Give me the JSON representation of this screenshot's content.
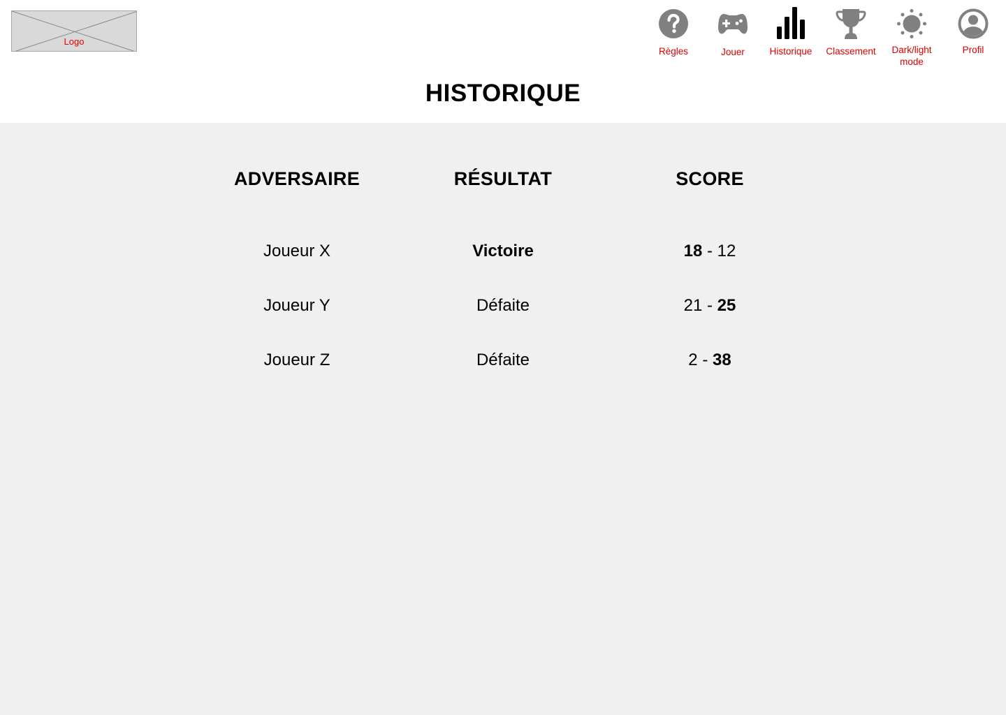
{
  "logo": {
    "label": "Logo"
  },
  "nav": [
    {
      "id": "regles",
      "label": "Règles",
      "icon": "question-circle-icon"
    },
    {
      "id": "jouer",
      "label": "Jouer",
      "icon": "gamepad-icon"
    },
    {
      "id": "historique",
      "label": "Historique",
      "icon": "bar-chart-icon"
    },
    {
      "id": "classement",
      "label": "Classement",
      "icon": "trophy-icon"
    },
    {
      "id": "mode",
      "label_line1": "Dark/light",
      "label_line2": "mode",
      "icon": "sun-icon"
    },
    {
      "id": "profil",
      "label": "Profil",
      "icon": "user-circle-icon"
    }
  ],
  "page_title": "HISTORIQUE",
  "table": {
    "headers": {
      "opponent": "ADVERSAIRE",
      "result": "RÉSULTAT",
      "score": "SCORE"
    },
    "rows": [
      {
        "opponent": "Joueur X",
        "result": "Victoire",
        "result_bold": true,
        "score_left": "18",
        "score_sep": " - ",
        "score_right": "12",
        "winner": "left"
      },
      {
        "opponent": "Joueur Y",
        "result": "Défaite",
        "result_bold": false,
        "score_left": "21",
        "score_sep": " - ",
        "score_right": "25",
        "winner": "right"
      },
      {
        "opponent": "Joueur Z",
        "result": "Défaite",
        "result_bold": false,
        "score_left": "2",
        "score_sep": " - ",
        "score_right": "38",
        "winner": "right"
      }
    ]
  },
  "colors": {
    "nav_label": "#e00000",
    "icon_gray": "#808080",
    "icon_active": "#000000",
    "main_bg": "#f0f0f0"
  }
}
